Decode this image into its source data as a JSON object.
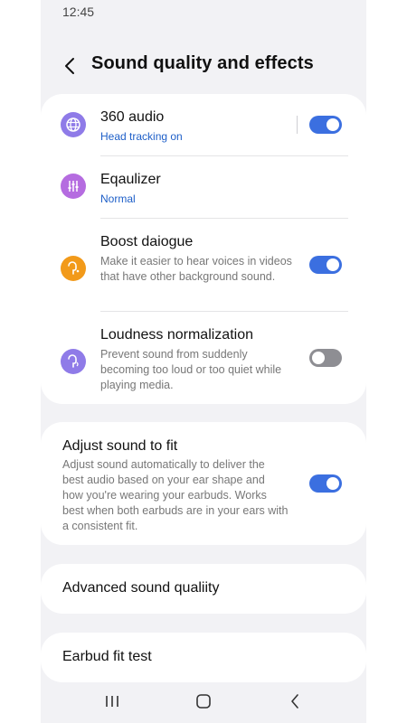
{
  "status": {
    "time": "12:45"
  },
  "header": {
    "title": "Sound quality and effects"
  },
  "audio_settings": [
    {
      "title": "360 audio",
      "subtitle": "Head tracking on",
      "toggle": "on",
      "icon": "globe-icon",
      "icon_color": "#8f7be8"
    },
    {
      "title": "Eqaulizer",
      "subtitle": "Normal",
      "icon": "equalizer-icon",
      "icon_color": "#b56ce0"
    },
    {
      "title": "Boost daiogue",
      "description": "Make it easier to hear voices in videos that have other background sound.",
      "toggle": "on",
      "icon": "earbud-voice-icon",
      "icon_color": "#f29a1a"
    },
    {
      "title": "Loudness normalization",
      "description": "Prevent sound from suddenly becoming too loud or too quiet while playing media.",
      "toggle": "off",
      "icon": "earbud-volume-icon",
      "icon_color": "#8f7be8"
    }
  ],
  "adjust_fit": {
    "title": "Adjust sound to fit",
    "description": "Adjust sound automatically to deliver the best audio based on your ear shape and how you're wearing your earbuds. Works best when both earbuds are in your ears with a consistent fit.",
    "toggle": "on"
  },
  "advanced": {
    "label": "Advanced sound qualiity"
  },
  "fit_test": {
    "label": "Earbud fit test"
  },
  "colors": {
    "accent": "#3b6fe0",
    "subtitle_blue": "#1e5fc8",
    "background": "#f2f2f5"
  },
  "navigation": [
    "recent-apps-icon",
    "home-icon",
    "back-icon"
  ]
}
